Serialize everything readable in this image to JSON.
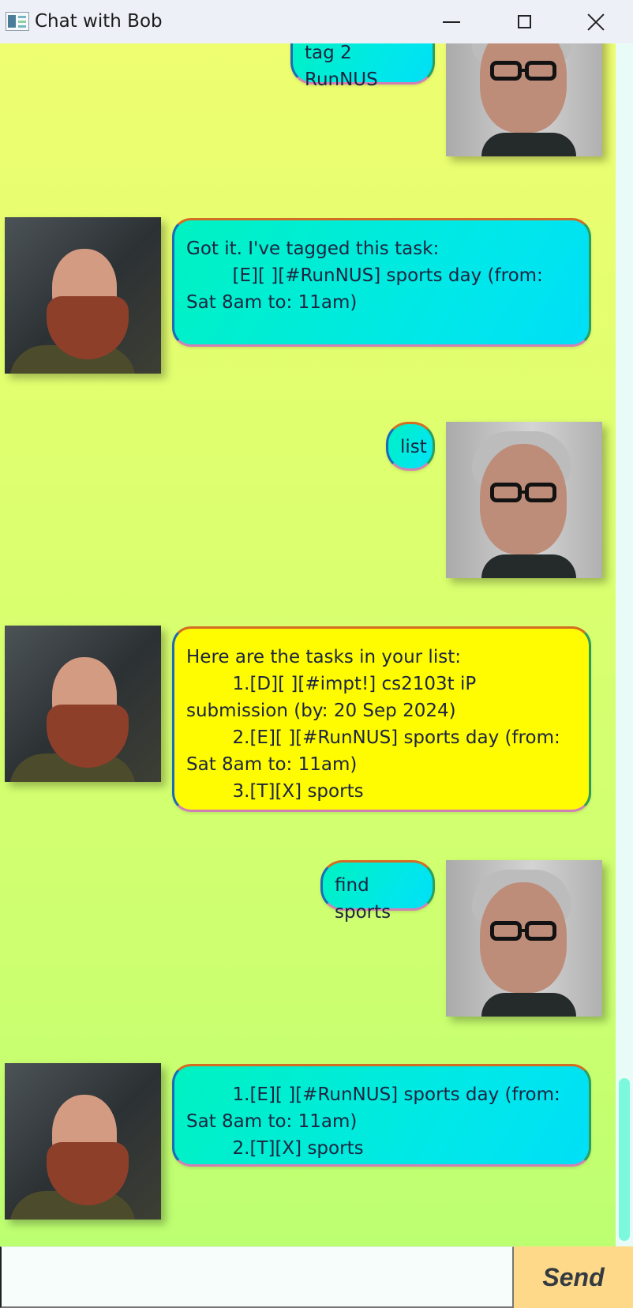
{
  "window": {
    "title": "Chat with Bob"
  },
  "window_controls": {
    "minimize": "minimize-icon",
    "maximize": "maximize-icon",
    "close": "close-icon"
  },
  "messages": [
    {
      "sender": "user",
      "text": "tag 2 RunNUS"
    },
    {
      "sender": "bot",
      "text": "Got it. I've tagged this task:\n\t[E][ ][#RunNUS] sports day (from: Sat 8am to: 11am)"
    },
    {
      "sender": "user",
      "text": "list"
    },
    {
      "sender": "bot",
      "text": "Here are the tasks in your list:\n\t1.[D][ ][#impt!] cs2103t iP submission (by: 20 Sep 2024)\n\t2.[E][ ][#RunNUS] sports day (from: Sat 8am to: 11am)\n\t3.[T][X] sports"
    },
    {
      "sender": "user",
      "text": "find sports"
    },
    {
      "sender": "bot",
      "text": "\t1.[E][ ][#RunNUS] sports day (from: Sat 8am to: 11am)\n\t2.[T][X] sports"
    }
  ],
  "input": {
    "value": "",
    "placeholder": ""
  },
  "send_button": {
    "label": "Send"
  },
  "colors": {
    "accent": "#00e7eb",
    "list_highlight": "#fffb00",
    "send": "#ffd98a",
    "background_top": "#eefe70",
    "background_bottom": "#bcff71"
  }
}
